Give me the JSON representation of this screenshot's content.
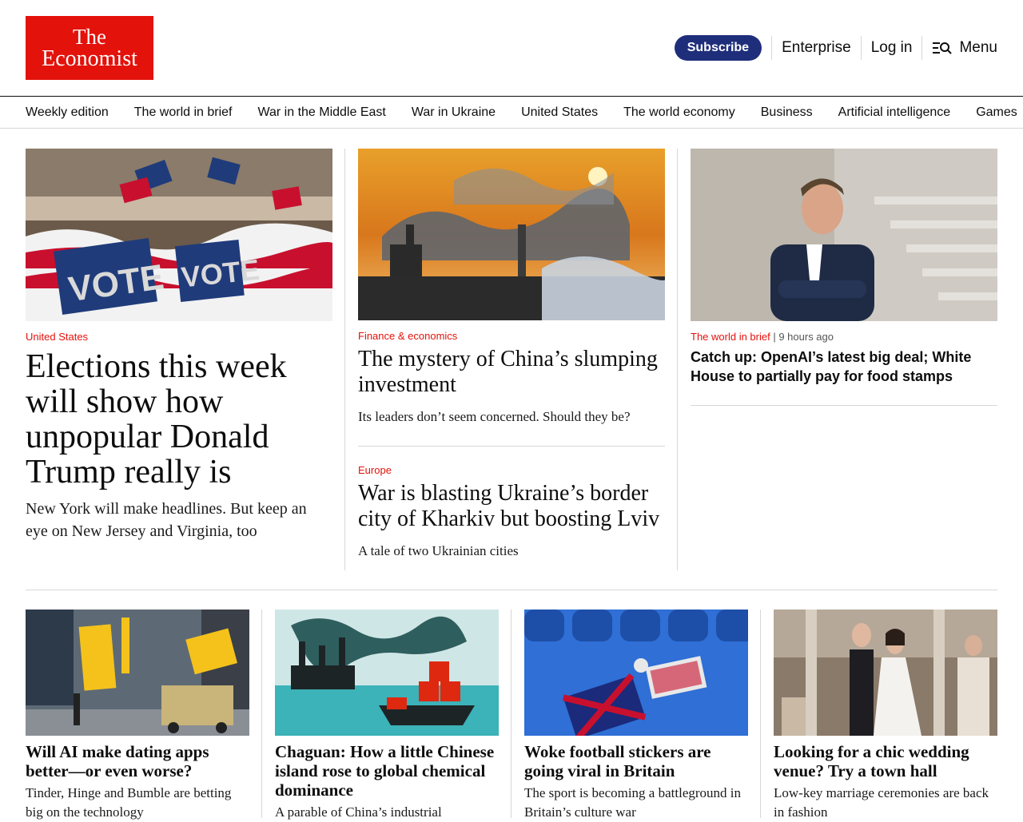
{
  "header": {
    "logo_line1": "The",
    "logo_line2": "Economist",
    "subscribe_label": "Subscribe",
    "enterprise_label": "Enterprise",
    "login_label": "Log in",
    "menu_label": "Menu"
  },
  "nav": {
    "items": [
      "Weekly edition",
      "The world in brief",
      "War in the Middle East",
      "War in Ukraine",
      "United States",
      "The world economy",
      "Business",
      "Artificial intelligence",
      "Games"
    ]
  },
  "lead": {
    "kicker": "United States",
    "headline": "Elections this week will show how unpopular Donald Trump really is",
    "dek": "New York will make headlines. But keep an eye on New Jersey and Virginia, too",
    "image_text_1": "VOTE",
    "image_text_2": "VOTE"
  },
  "middle": [
    {
      "kicker": "Finance & economics",
      "headline": "The mystery of China’s slumping investment",
      "dek": "Its leaders don’t seem concerned. Should they be?"
    },
    {
      "kicker": "Europe",
      "headline": "War is blasting Ukraine’s border city of Kharkiv but boosting Lviv",
      "dek": "A tale of two Ukrainian cities"
    }
  ],
  "brief": {
    "kicker": "The world in brief",
    "time": "9 hours ago",
    "headline": "Catch up: OpenAI’s latest big deal; White House to partially pay for food stamps"
  },
  "bottom": [
    {
      "headline": "Will AI make dating apps better—or even worse?",
      "dek": "Tinder, Hinge and Bumble are betting big on the technology"
    },
    {
      "headline": "Chaguan: How a little Chinese island rose to global chemical dominance",
      "dek": "A parable of China’s industrial"
    },
    {
      "headline": "Woke football stickers are going viral in Britain",
      "dek": "The sport is becoming a battleground in Britain’s culture war"
    },
    {
      "headline": "Looking for a chic wedding venue? Try a town hall",
      "dek": "Low-key marriage ceremonies are back in fashion"
    }
  ]
}
